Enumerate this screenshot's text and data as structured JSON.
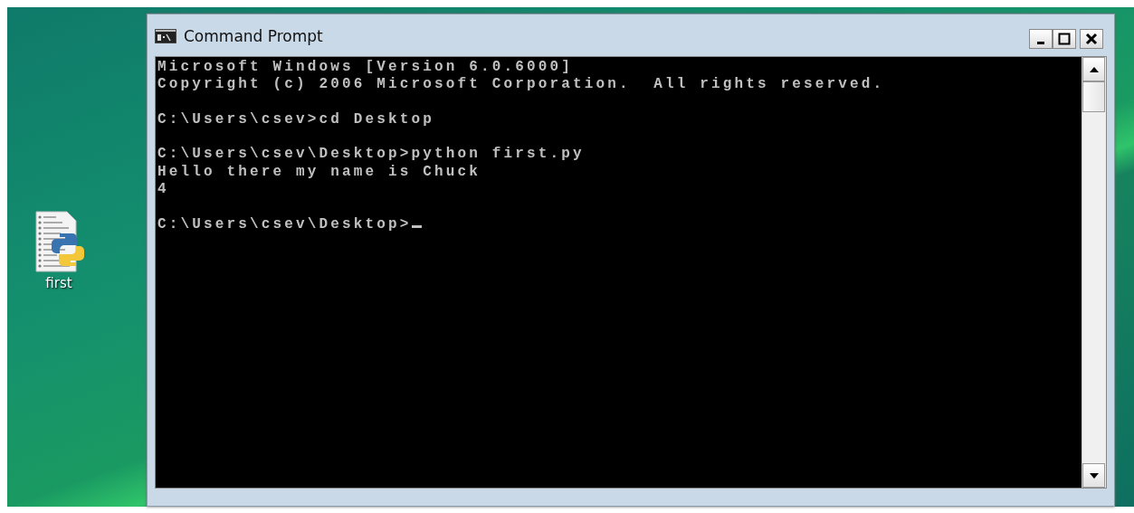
{
  "desktop": {
    "icons": [
      {
        "label": "first"
      }
    ]
  },
  "window": {
    "title": "Command Prompt",
    "console": {
      "blocks": [
        [
          "Microsoft Windows [Version 6.0.6000]",
          "Copyright (c) 2006 Microsoft Corporation.  All rights reserved."
        ],
        [
          "C:\\Users\\csev>cd Desktop"
        ],
        [
          "C:\\Users\\csev\\Desktop>python first.py",
          "Hello there my name is Chuck",
          "4"
        ],
        [
          "C:\\Users\\csev\\Desktop>"
        ]
      ],
      "cursor": true
    }
  }
}
